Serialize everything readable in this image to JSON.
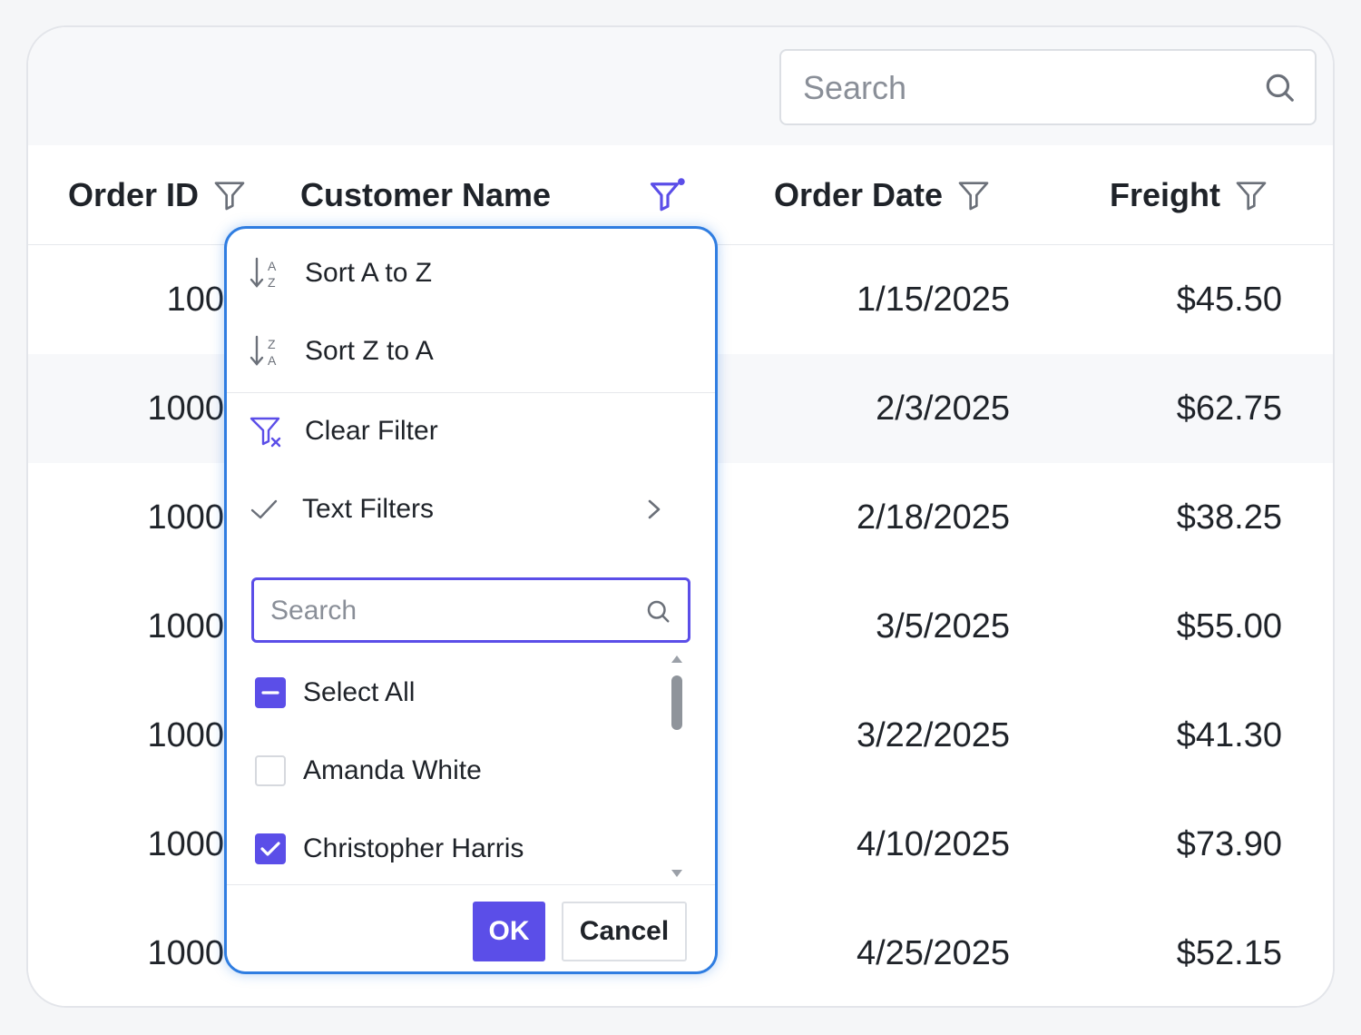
{
  "colors": {
    "accent": "#5b4ee8",
    "popup_border": "#2f7de1",
    "border": "#e6e8ec",
    "text": "#1f2329",
    "alt_row": "#f7f8fa"
  },
  "toolbar": {
    "search": {
      "placeholder": "Search",
      "icon": "search-icon"
    }
  },
  "columns": [
    {
      "label": "Order ID",
      "icon": "filter-icon"
    },
    {
      "label": "Customer Name",
      "icon": "filter-active-icon"
    },
    {
      "label": "Order Date",
      "icon": "filter-icon"
    },
    {
      "label": "Freight",
      "icon": "filter-icon"
    }
  ],
  "rows": [
    {
      "order_id": "100",
      "order_date": "1/15/2025",
      "freight": "$45.50"
    },
    {
      "order_id": "1000",
      "order_date": "2/3/2025",
      "freight": "$62.75"
    },
    {
      "order_id": "1000",
      "order_date": "2/18/2025",
      "freight": "$38.25"
    },
    {
      "order_id": "1000",
      "order_date": "3/5/2025",
      "freight": "$55.00"
    },
    {
      "order_id": "1000",
      "order_date": "3/22/2025",
      "freight": "$41.30"
    },
    {
      "order_id": "1000",
      "order_date": "4/10/2025",
      "freight": "$73.90"
    },
    {
      "order_id": "1000",
      "order_date": "4/25/2025",
      "freight": "$52.15"
    }
  ],
  "filter_popup": {
    "menu": [
      {
        "label": "Sort A to Z",
        "icon": "sort-ascending-icon"
      },
      {
        "label": "Sort Z to A",
        "icon": "sort-descending-icon"
      },
      {
        "label": "Clear Filter",
        "icon": "clear-filter-icon"
      },
      {
        "label": "Text Filters",
        "icon": "check-icon",
        "submenu_icon": "chevron-right-icon"
      }
    ],
    "search": {
      "placeholder": "Search",
      "icon": "search-icon"
    },
    "checklist": [
      {
        "label": "Select All",
        "state": "indeterminate"
      },
      {
        "label": "Amanda White",
        "state": "unchecked"
      },
      {
        "label": "Christopher Harris",
        "state": "checked"
      }
    ],
    "buttons": {
      "ok": "OK",
      "cancel": "Cancel"
    }
  }
}
